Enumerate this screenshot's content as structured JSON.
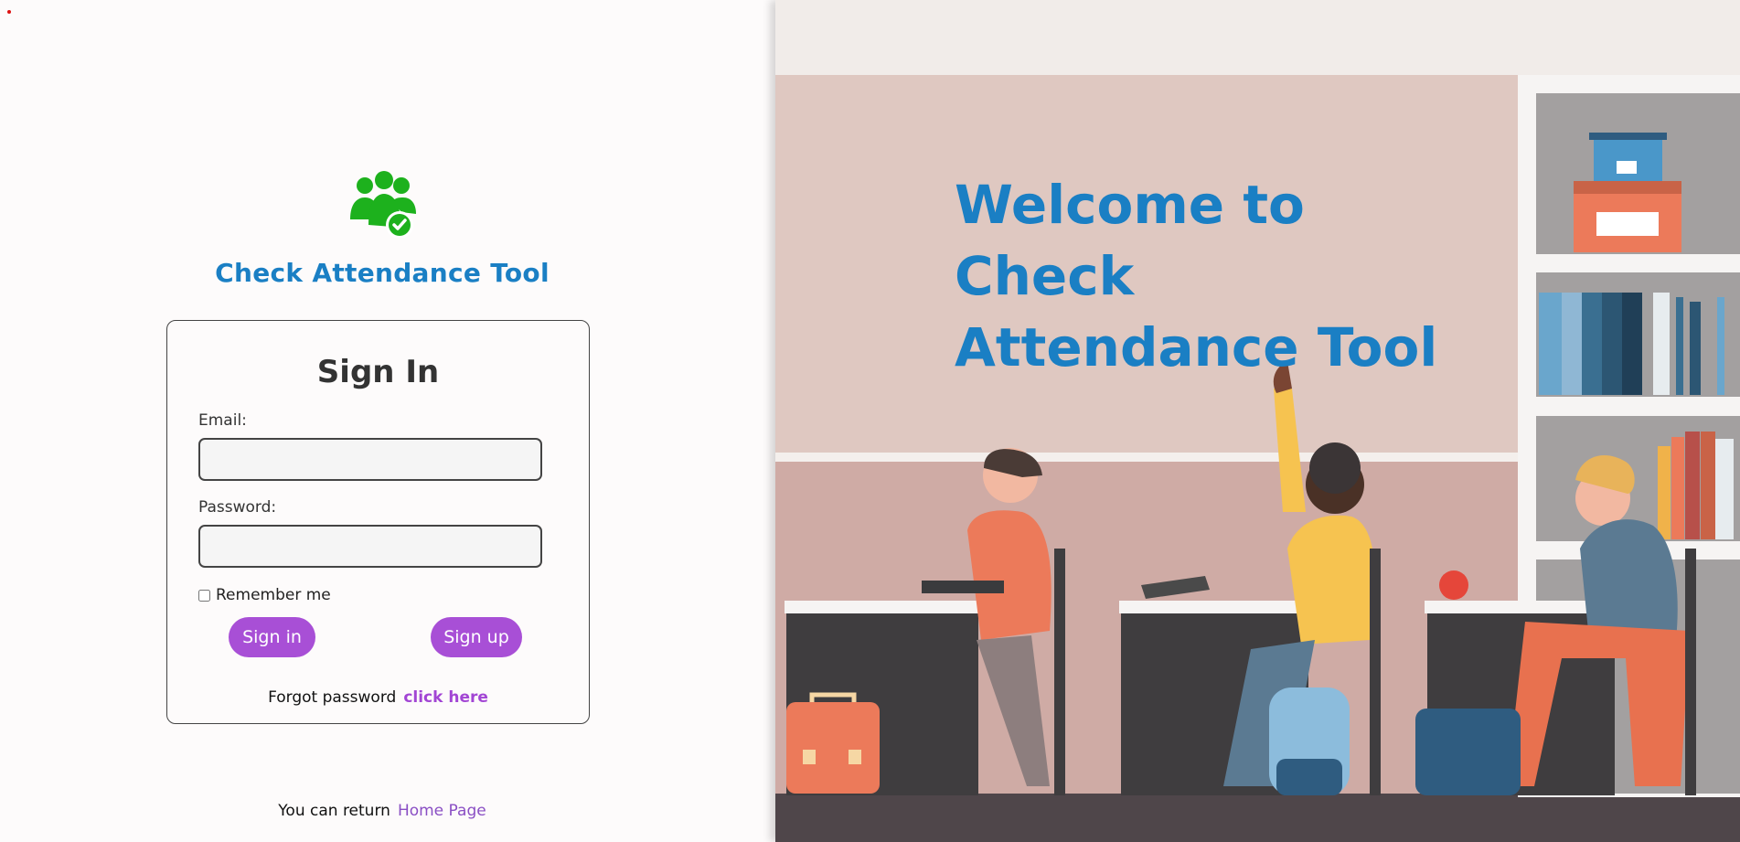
{
  "app": {
    "title": "Check Attendance Tool",
    "welcome": "Welcome to Check Attendance Tool",
    "logo_icon": "team-check-icon"
  },
  "signin": {
    "heading": "Sign In",
    "email_label": "Email:",
    "email_value": "",
    "password_label": "Password:",
    "password_value": "",
    "remember_label": "Remember me",
    "remember_checked": false,
    "signin_button": "Sign in",
    "signup_button": "Sign up",
    "forgot_text": "Forgot password",
    "forgot_link": "click here"
  },
  "footer": {
    "return_text": "You can return",
    "home_link": "Home Page"
  },
  "colors": {
    "brand_blue": "#1a7fc4",
    "button_purple": "#a84fd6",
    "logo_green": "#1db11d"
  }
}
